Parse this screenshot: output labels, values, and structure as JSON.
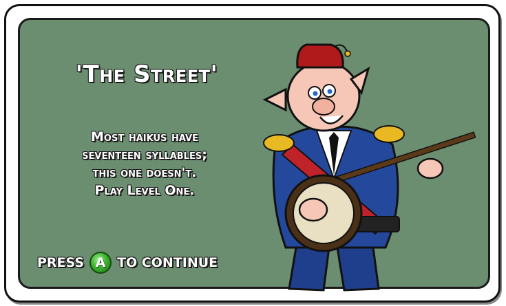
{
  "title": "'The Street'",
  "haiku": {
    "lines": [
      "Most haikus have",
      "seventeen syllables;",
      "this one doesn't.",
      "Play Level One."
    ]
  },
  "prompt": {
    "press": "PRESS",
    "button": "A",
    "continue": "TO CONTINUE"
  },
  "colors": {
    "panel_bg": "#6b8d70",
    "button_green": "#3fb232"
  },
  "icons": {
    "button": "a-button-icon",
    "character": "banjo-pig-character"
  }
}
